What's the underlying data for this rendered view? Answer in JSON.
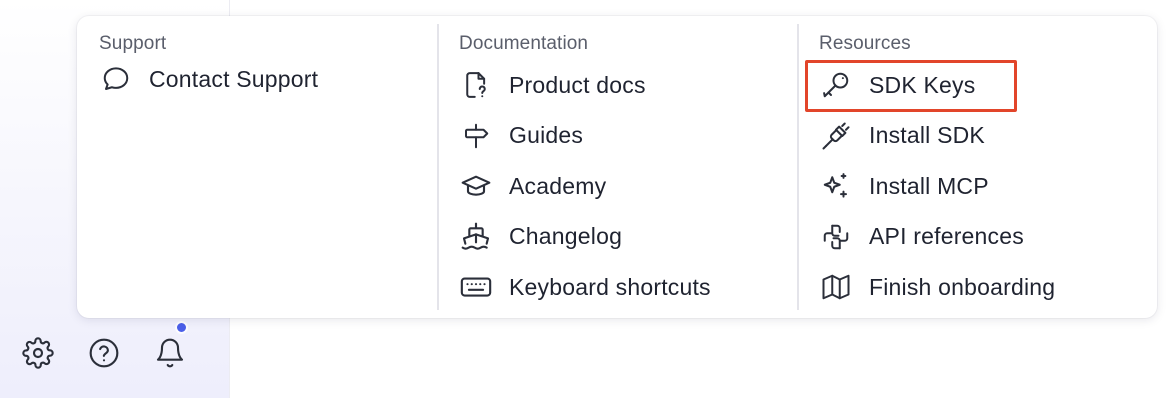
{
  "menu": {
    "support": {
      "title": "Support",
      "items": [
        {
          "label": "Contact Support",
          "icon": "chat-bubble-icon"
        }
      ]
    },
    "documentation": {
      "title": "Documentation",
      "items": [
        {
          "label": "Product docs",
          "icon": "document-question-icon"
        },
        {
          "label": "Guides",
          "icon": "signpost-icon"
        },
        {
          "label": "Academy",
          "icon": "graduation-cap-icon"
        },
        {
          "label": "Changelog",
          "icon": "ship-icon"
        },
        {
          "label": "Keyboard shortcuts",
          "icon": "keyboard-icon"
        }
      ]
    },
    "resources": {
      "title": "Resources",
      "items": [
        {
          "label": "SDK Keys",
          "icon": "key-icon",
          "highlighted": true
        },
        {
          "label": "Install SDK",
          "icon": "plug-icon"
        },
        {
          "label": "Install MCP",
          "icon": "sparkles-icon"
        },
        {
          "label": "API references",
          "icon": "webhook-icon"
        },
        {
          "label": "Finish onboarding",
          "icon": "map-icon"
        }
      ]
    }
  },
  "sidebar": {
    "bottom_icons": [
      "gear-icon",
      "help-circle-icon",
      "bell-icon"
    ],
    "notification_dot": true
  },
  "colors": {
    "highlight": "#e2452a",
    "notification": "#4b5fe8"
  }
}
